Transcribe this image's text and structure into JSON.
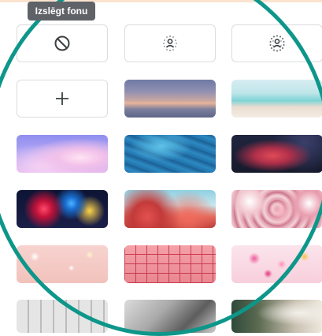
{
  "tooltip": {
    "text": "Izslēgt fonu"
  },
  "options": [
    {
      "name": "no-background",
      "icon": "block-icon"
    },
    {
      "name": "slight-blur",
      "icon": "blur-person-icon"
    },
    {
      "name": "blur",
      "icon": "blur-person-strong-icon"
    },
    {
      "name": "add-image",
      "icon": "plus-icon"
    }
  ],
  "colors": {
    "ring": "#0d968a",
    "border": "#dadce0",
    "icon": "#5f6368"
  }
}
